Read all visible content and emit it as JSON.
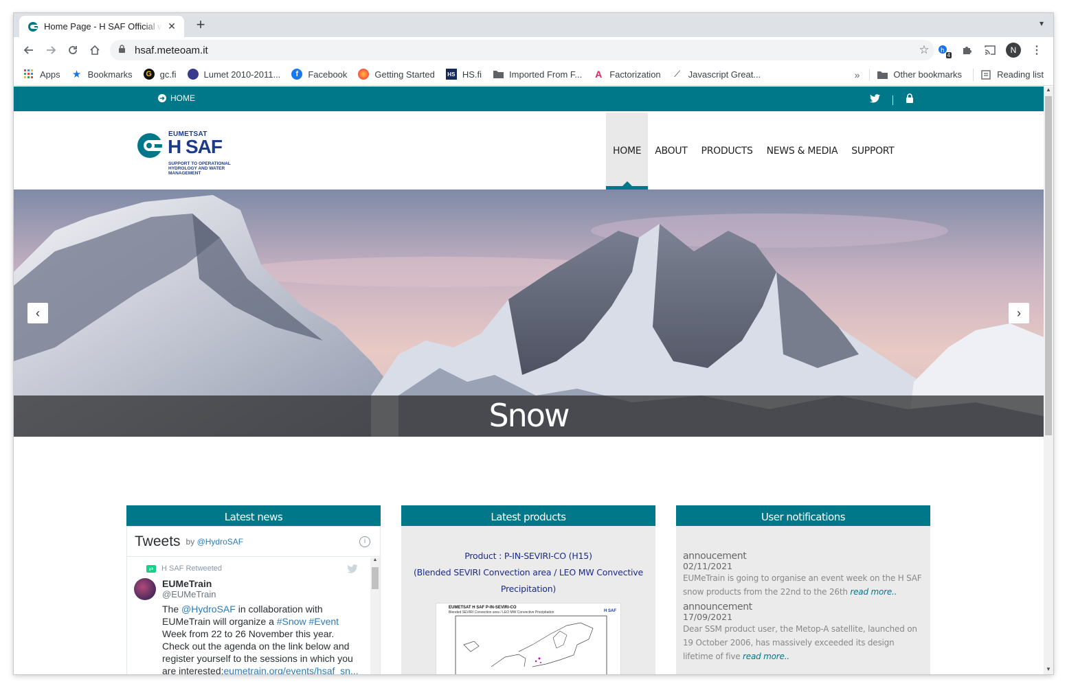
{
  "browser": {
    "tab_title": "Home Page - H SAF Official w",
    "new_tab": "+",
    "url": "hsaf.meteoam.it",
    "ext_badge": "4",
    "profile_initial": "N",
    "bookmarks": [
      {
        "label": "Apps",
        "icon": "apps-grid-icon"
      },
      {
        "label": "Bookmarks",
        "icon": "star-icon"
      },
      {
        "label": "gc.fi",
        "icon": "gc-icon"
      },
      {
        "label": "Lumet 2010-2011...",
        "icon": "lumet-icon"
      },
      {
        "label": "Facebook",
        "icon": "facebook-icon"
      },
      {
        "label": "Getting Started",
        "icon": "firefox-icon"
      },
      {
        "label": "HS.fi",
        "icon": "hs-icon"
      },
      {
        "label": "Imported From F...",
        "icon": "folder-icon"
      },
      {
        "label": "Factorization",
        "icon": "factorization-icon"
      },
      {
        "label": "Javascript Great...",
        "icon": "javascript-icon"
      }
    ],
    "more_bookmarks": "»",
    "other_bookmarks": "Other bookmarks",
    "reading_list": "Reading list"
  },
  "site": {
    "topbar_home": "HOME",
    "logo": {
      "eumetsat": "EUMETSAT",
      "name": "H SAF",
      "tagline_1": "SUPPORT TO OPERATIONAL",
      "tagline_2": "HYDROLOGY AND WATER",
      "tagline_3": "MANAGEMENT"
    },
    "nav": [
      "HOME",
      "ABOUT",
      "PRODUCTS",
      "NEWS & MEDIA",
      "SUPPORT"
    ],
    "hero_caption": "Snow",
    "panels": {
      "news": {
        "heading": "Latest news",
        "twitter_title": "Tweets",
        "twitter_by": "by",
        "twitter_handle": "@HydroSAF",
        "retweeted": "H SAF Retweeted",
        "user_name": "EUMeTrain",
        "user_handle": "@EUMeTrain",
        "text_1": "The ",
        "mention": "@HydroSAF",
        "text_2": "  in collaboration with EUMeTrain will organize a ",
        "hashtags": "#Snow #Event",
        "text_3": " Week from 22 to 26 November this year. Check out the agenda on the link below and register yourself to the sessions in which you are interested:",
        "link": "eumetrain.org/events/hsaf_sn..."
      },
      "products": {
        "heading": "Latest products",
        "line_1": "Product : P-IN-SEVIRI-CO (H15)",
        "line_2": "(Blended SEVIRI Convection area / LEO MW Convective",
        "line_3": "Precipitation)",
        "image_title": "EUMETSAT H SAF P-IN-SEVIRI-CO",
        "image_subtitle": "Blended SEVIRI Convection area / LEO MW Convective Precipitation",
        "image_logo": "H SAF"
      },
      "notifications": {
        "heading": "User notifications",
        "items": [
          {
            "title": "annoucement",
            "date": "02/11/2021",
            "text": "EUMeTrain is going to organise an event week on the H SAF snow products from the 22nd to the 26th ",
            "more": "read more.."
          },
          {
            "title": "announcement",
            "date": "17/09/2021",
            "text": "Dear SSM product user, the Metop-A satellite, launched on 19 October 2006, has massively exceeded its design lifetime of five ",
            "more": "read more.."
          }
        ]
      }
    }
  },
  "colors": {
    "brand_teal": "#00788a",
    "panel_bg": "#ebebeb",
    "link_blue": "#2b7bb9"
  }
}
